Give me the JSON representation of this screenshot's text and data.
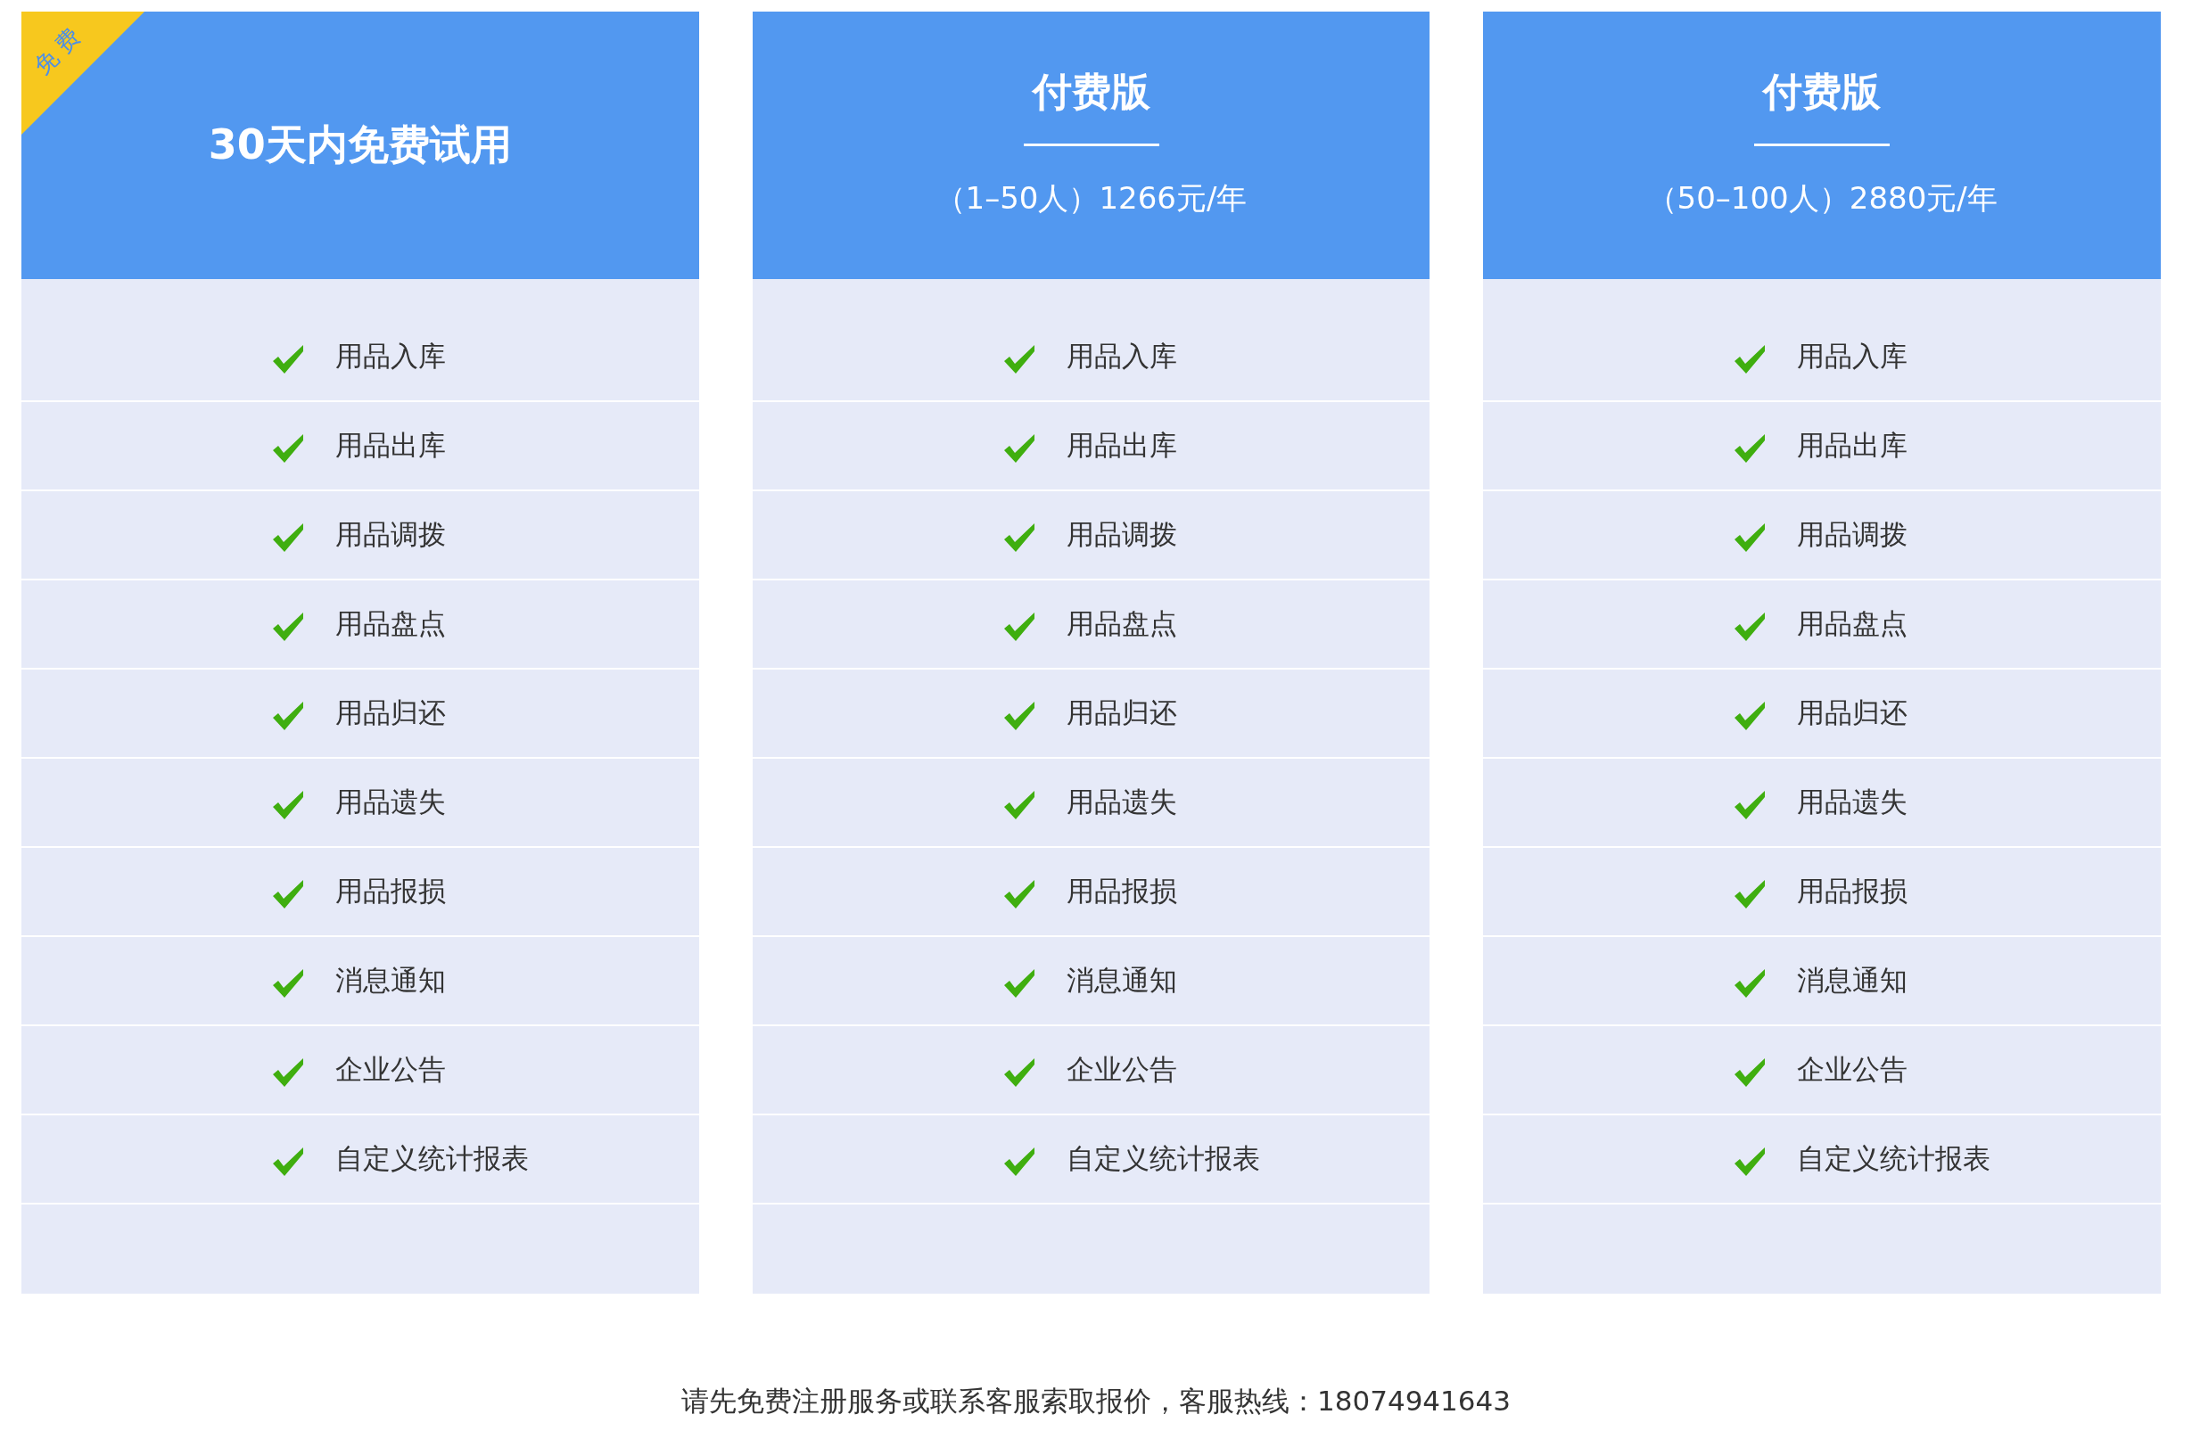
{
  "plans": [
    {
      "kind": "trial",
      "ribbon": "免费",
      "title": "30天内免费试用",
      "features": [
        "用品入库",
        "用品出库",
        "用品调拨",
        "用品盘点",
        "用品归还",
        "用品遗失",
        "用品报损",
        "消息通知",
        "企业公告",
        "自定义统计报表"
      ]
    },
    {
      "kind": "paid",
      "title": "付费版",
      "price": "（1–50人）1266元/年",
      "features": [
        "用品入库",
        "用品出库",
        "用品调拨",
        "用品盘点",
        "用品归还",
        "用品遗失",
        "用品报损",
        "消息通知",
        "企业公告",
        "自定义统计报表"
      ]
    },
    {
      "kind": "paid",
      "title": "付费版",
      "price": "（50–100人）2880元/年",
      "features": [
        "用品入库",
        "用品出库",
        "用品调拨",
        "用品盘点",
        "用品归还",
        "用品遗失",
        "用品报损",
        "消息通知",
        "企业公告",
        "自定义统计报表"
      ]
    }
  ],
  "footer": "请先免费注册服务或联系客服索取报价，客服热线：18074941643"
}
